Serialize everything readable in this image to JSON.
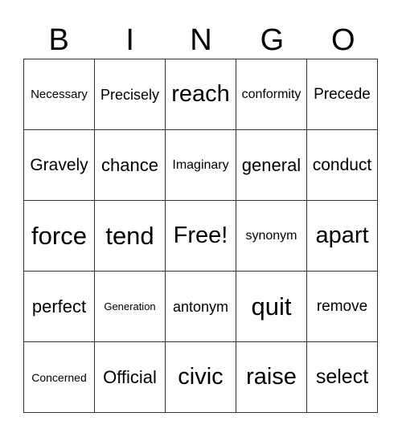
{
  "header": [
    "B",
    "I",
    "N",
    "G",
    "O"
  ],
  "cells": [
    [
      "Necessary",
      "Precisely",
      "reach",
      "conformity",
      "Precede"
    ],
    [
      "Gravely",
      "chance",
      "Imaginary",
      "general",
      "conduct"
    ],
    [
      "force",
      "tend",
      "Free!",
      "synonym",
      "apart"
    ],
    [
      "perfect",
      "Generation",
      "antonym",
      "quit",
      "remove"
    ],
    [
      "Concerned",
      "Official",
      "civic",
      "raise",
      "select"
    ]
  ]
}
